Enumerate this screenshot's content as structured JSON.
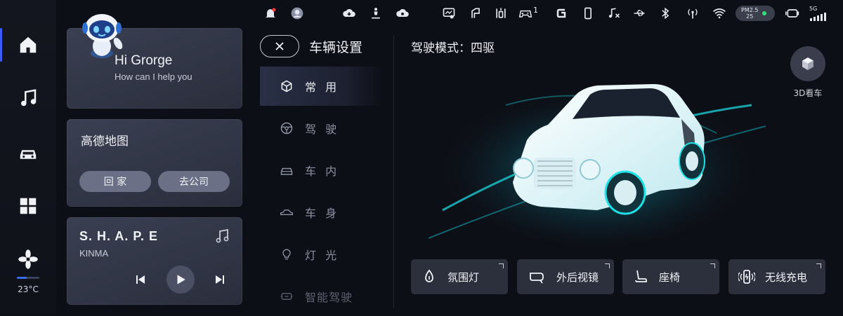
{
  "status_bar": {
    "icons": [
      "notification-bell-icon",
      "user-avatar-icon",
      "download-icon",
      "person-seat-icon",
      "cloud-settings-icon",
      "camera-monitor-icon",
      "window-icon",
      "seat-adjust-icon",
      "gamepad-icon",
      "g-logo-icon",
      "phone-icon",
      "music-mute-icon",
      "usb-icon",
      "bluetooth-icon",
      "signal-antenna-icon",
      "wifi-icon",
      "air-quality-icon",
      "dashcam-icon",
      "5g-signal-icon"
    ],
    "gamepad_count": "1",
    "air_quality": {
      "label": "PM2.5",
      "value": "25",
      "status_color": "#2ee07a"
    },
    "network_label": "5G",
    "accent_color": "#3b5bff"
  },
  "left_rail": {
    "items": [
      "home-icon",
      "music-icon",
      "car-icon",
      "apps-grid-icon"
    ],
    "fan_icon": "fan-icon",
    "temperature": "23°C"
  },
  "assistant_card": {
    "greeting": "Hi Grorge",
    "subtitle": "How can I help you"
  },
  "map_card": {
    "title": "高德地图",
    "buttons": [
      "回 家",
      "去公司"
    ]
  },
  "music_card": {
    "song": "S. H. A. P. E",
    "artist": "KINMA"
  },
  "settings": {
    "title": "车辆设置",
    "menu": [
      {
        "label": "常 用",
        "icon": "cube-icon",
        "active": true
      },
      {
        "label": "驾 驶",
        "icon": "steering-wheel-icon"
      },
      {
        "label": "车 内",
        "icon": "car-interior-icon"
      },
      {
        "label": "车 身",
        "icon": "car-body-icon"
      },
      {
        "label": "灯 光",
        "icon": "light-bulb-icon"
      },
      {
        "label": "智能驾驶",
        "icon": "smart-drive-icon"
      }
    ]
  },
  "main": {
    "drive_mode": "驾驶模式：四驱",
    "view_3d_label": "3D看车",
    "quick_buttons": [
      {
        "label": "氛围灯",
        "icon": "ambient-light-icon"
      },
      {
        "label": "外后视镜",
        "icon": "mirror-icon"
      },
      {
        "label": "座椅",
        "icon": "seat-icon"
      },
      {
        "label": "无线充电",
        "icon": "wireless-charging-icon"
      }
    ]
  }
}
